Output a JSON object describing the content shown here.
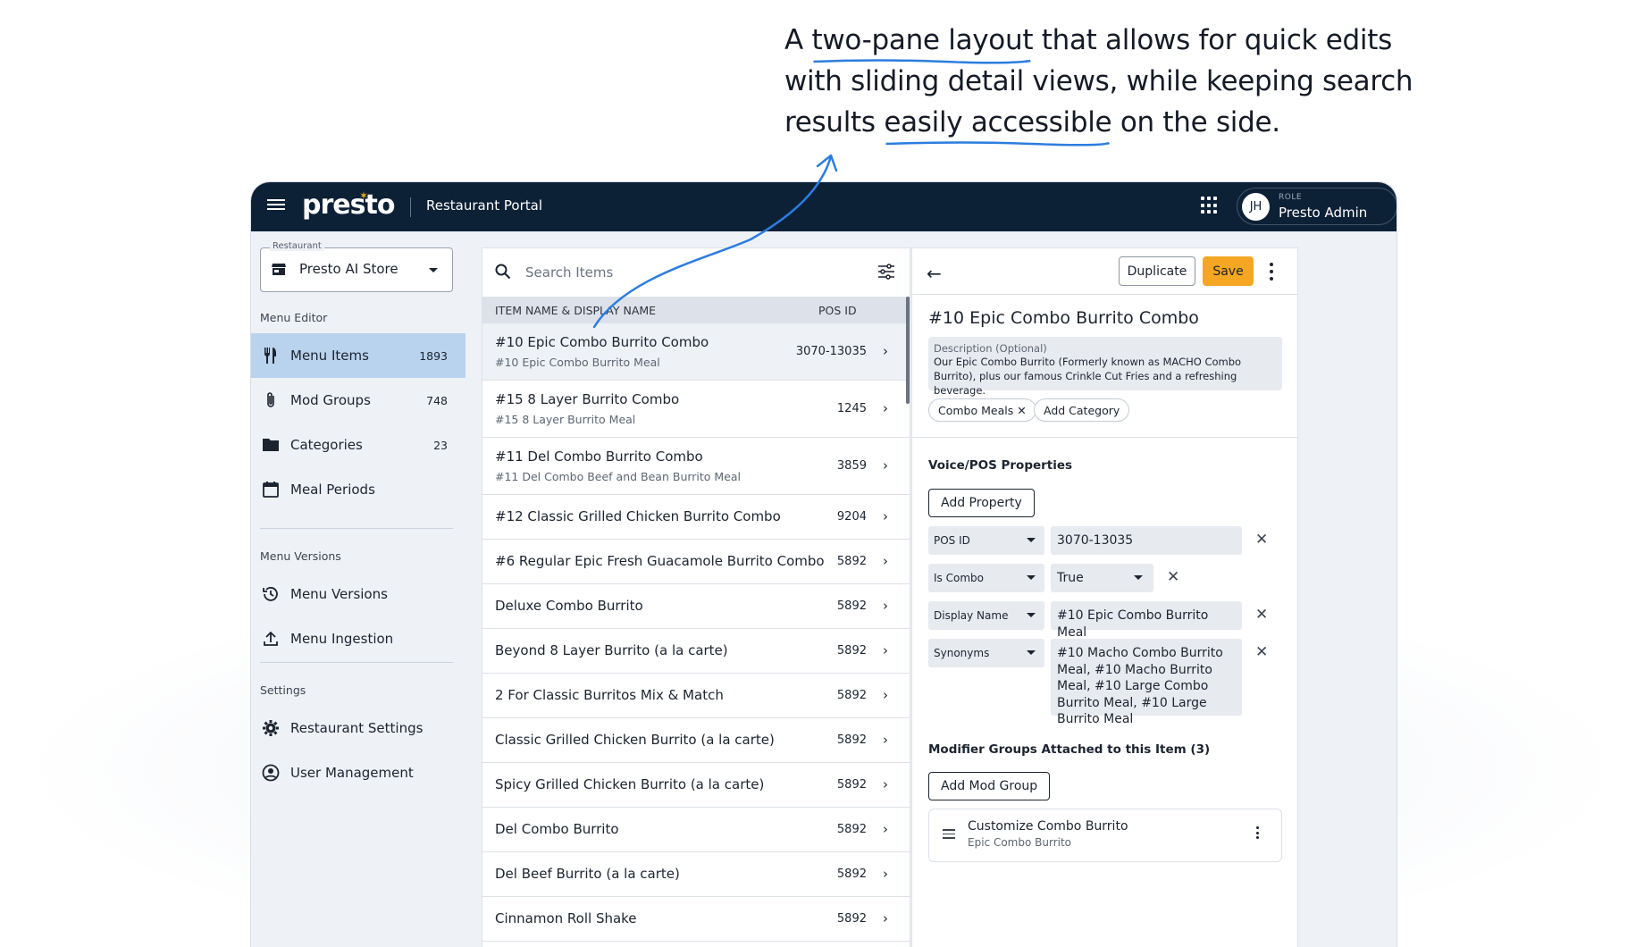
{
  "caption": {
    "prefix": "A ",
    "highlight1": "two-pane layout",
    "middle": " that allows for quick edits with sliding detail views, while keeping search results ",
    "highlight2": "easily accessible",
    "suffix": " on the side."
  },
  "colors": {
    "topbar": "#0d2136",
    "accent": "#f5a623",
    "active_nav": "#b9d3ee",
    "annotation": "#2b7de0"
  },
  "topbar": {
    "logo": "presto",
    "portal": "Restaurant Portal",
    "apps_icon": "apps-grid-icon",
    "user_initials": "JH",
    "user_role": "ROLE",
    "user_name": "Presto Admin"
  },
  "sidebar": {
    "restaurant_label": "Restaurant",
    "restaurant_value": "Presto AI Store",
    "sections": {
      "menu_editor": "Menu Editor",
      "menu_versions": "Menu Versions",
      "settings": "Settings"
    },
    "items": [
      {
        "label": "Menu Items",
        "count": "1893",
        "icon": "utensils-icon",
        "active": true
      },
      {
        "label": "Mod Groups",
        "count": "748",
        "icon": "paperclip-icon"
      },
      {
        "label": "Categories",
        "count": "23",
        "icon": "folder-icon"
      },
      {
        "label": "Meal Periods",
        "count": "",
        "icon": "calendar-icon"
      },
      {
        "label": "Menu Versions",
        "count": "",
        "icon": "history-icon"
      },
      {
        "label": "Menu Ingestion",
        "count": "",
        "icon": "upload-icon"
      },
      {
        "label": "Restaurant Settings",
        "count": "",
        "icon": "gear-icon"
      },
      {
        "label": "User Management",
        "count": "",
        "icon": "user-circle-icon"
      }
    ]
  },
  "list": {
    "search_placeholder": "Search Items",
    "col_name": "ITEM NAME & DISPLAY NAME",
    "col_pos": "POS ID",
    "rows": [
      {
        "name": "#10 Epic Combo Burrito Combo",
        "display": "#10 Epic Combo Burrito Meal",
        "pos": "3070-13035",
        "selected": true
      },
      {
        "name": "#15 8 Layer Burrito Combo",
        "display": "#15 8 Layer Burrito Meal",
        "pos": "1245"
      },
      {
        "name": "#11 Del Combo Burrito Combo",
        "display": "#11 Del Combo Beef and Bean Burrito Meal",
        "pos": "3859"
      },
      {
        "name": "#12 Classic Grilled Chicken Burrito Combo",
        "display": "",
        "pos": "9204"
      },
      {
        "name": "#6 Regular Epic Fresh Guacamole Burrito Combo",
        "display": "",
        "pos": "5892"
      },
      {
        "name": "Deluxe Combo Burrito",
        "display": "",
        "pos": "5892"
      },
      {
        "name": "Beyond 8 Layer Burrito (a la carte)",
        "display": "",
        "pos": "5892"
      },
      {
        "name": "2 For Classic Burritos Mix & Match",
        "display": "",
        "pos": "5892"
      },
      {
        "name": "Classic Grilled Chicken Burrito (a la carte)",
        "display": "",
        "pos": "5892"
      },
      {
        "name": "Spicy Grilled Chicken Burrito (a la carte)",
        "display": "",
        "pos": "5892"
      },
      {
        "name": "Del Combo Burrito",
        "display": "",
        "pos": "5892"
      },
      {
        "name": "Del Beef Burrito (a la carte)",
        "display": "",
        "pos": "5892"
      },
      {
        "name": "Cinnamon Roll Shake",
        "display": "",
        "pos": "5892"
      }
    ]
  },
  "detail": {
    "duplicate": "Duplicate",
    "save": "Save",
    "title": "#10 Epic Combo Burrito Combo",
    "desc_label": "Description (Optional)",
    "desc_text": "Our Epic Combo Burrito (Formerly known as MACHO Combo Burrito), plus our famous Crinkle Cut Fries and a refreshing beverage.",
    "chip_category": "Combo Meals",
    "add_category": "Add Category",
    "props_heading": "Voice/POS Properties",
    "add_property": "Add Property",
    "properties": [
      {
        "key": "POS ID",
        "value": "3070-13035"
      },
      {
        "key": "Is Combo",
        "value": "True"
      },
      {
        "key": "Display Name",
        "value": "#10 Epic Combo Burrito Meal"
      },
      {
        "key": "Synonyms",
        "value": "#10 Macho Combo Burrito Meal, #10 Macho Burrito Meal, #10 Large Combo Burrito Meal, #10 Large Burrito Meal"
      }
    ],
    "mod_heading": "Modifier Groups Attached to this Item (3)",
    "add_mod": "Add Mod Group",
    "mod_card_title": "Customize Combo Burrito",
    "mod_card_sub": "Epic Combo Burrito"
  }
}
